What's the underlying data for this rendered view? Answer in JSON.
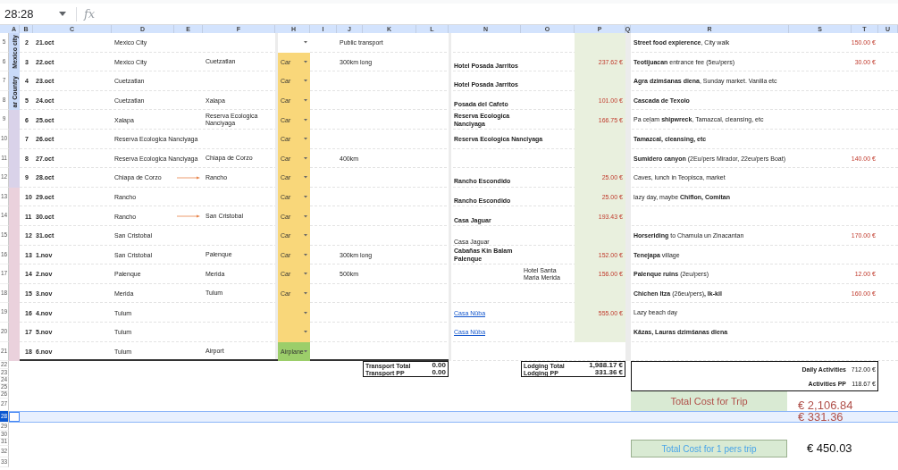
{
  "formula_bar": {
    "cell_ref": "28:28",
    "function_label": "fx"
  },
  "column_headers": [
    "A",
    "B",
    "C",
    "D",
    "E",
    "F",
    "H",
    "I",
    "J",
    "K",
    "L",
    "N",
    "O",
    "P",
    "Q",
    "R",
    "S",
    "T",
    "U"
  ],
  "row_headers": [
    {
      "label": "5",
      "selected": false
    },
    {
      "label": "6",
      "selected": false
    },
    {
      "label": "7",
      "selected": false
    },
    {
      "label": "8",
      "selected": false
    },
    {
      "label": "9",
      "selected": false
    },
    {
      "label": "10",
      "selected": false
    },
    {
      "label": "11",
      "selected": false
    },
    {
      "label": "12",
      "selected": false
    },
    {
      "label": "13",
      "selected": false
    },
    {
      "label": "14",
      "selected": false
    },
    {
      "label": "15",
      "selected": false
    },
    {
      "label": "16",
      "selected": false
    },
    {
      "label": "17",
      "selected": false
    },
    {
      "label": "18",
      "selected": false
    },
    {
      "label": "19",
      "selected": false
    },
    {
      "label": "20",
      "selected": false
    },
    {
      "label": "21",
      "selected": false
    },
    {
      "label": "22",
      "selected": false
    },
    {
      "label": "23",
      "selected": false
    },
    {
      "label": "24",
      "selected": false
    },
    {
      "label": "25",
      "selected": false
    },
    {
      "label": "26",
      "selected": false
    },
    {
      "label": "27",
      "selected": false
    },
    {
      "label": "28",
      "selected": true
    },
    {
      "label": "29",
      "selected": false
    },
    {
      "label": "30",
      "selected": false
    },
    {
      "label": "31",
      "selected": false
    },
    {
      "label": "32",
      "selected": false
    },
    {
      "label": "33",
      "selected": false
    }
  ],
  "groups": [
    {
      "label": "Mexico city",
      "color": "#c9daf8",
      "rows": [
        {
          "num": "2",
          "date": "21.oct",
          "from": "Mexico City",
          "transport": {
            "color": "#ffffff"
          },
          "note": "Public transport",
          "activity": {
            "text": "**Street food expierence**, City walk",
            "bold": false
          },
          "activity_cost": "150.00 €"
        },
        {
          "num": "3",
          "date": "22.oct",
          "from": "Mexico City",
          "to": "Cuetzatlan",
          "transport": {
            "value": "Car",
            "color": "#f9d77a"
          },
          "note": "300km long",
          "lodging": {
            "text": "Hotel Posada Jarritos",
            "kind": "bold"
          },
          "price": "237.62 €",
          "activity": {
            "text": "**Teotijuacan** entrance fee (5eu/pers)",
            "bold": false
          },
          "activity_cost": "30.00 €"
        }
      ]
    },
    {
      "label": "ar Country",
      "color": "#c9daf8",
      "rows": [
        {
          "num": "4",
          "date": "23.oct",
          "from": "Cuetzatlan",
          "transport": {
            "value": "Car",
            "color": "#f9d77a"
          },
          "lodging": {
            "text": "Hotel Posada Jarritos",
            "kind": "bold"
          },
          "activity": {
            "text": "**Agra dzimšanas diena**, Sunday market. Vanilla etc",
            "bold": false
          }
        },
        {
          "num": "5",
          "date": "24.oct",
          "from": "Cuetzatlan",
          "to": "Xalapa",
          "transport": {
            "value": "Car",
            "color": "#f9d77a"
          },
          "lodging": {
            "text": "Posada del Cafeto",
            "kind": "bold"
          },
          "price": "101.00 €",
          "activity": {
            "text": "Cascada de Texolo",
            "bold": true
          }
        }
      ]
    },
    {
      "color": "#d9d2e9",
      "rows": [
        {
          "num": "6",
          "date": "25.oct",
          "from": "Xalapa",
          "to": "Reserva Ecologica Nanciyaga",
          "transport": {
            "value": "Car",
            "color": "#f9d77a"
          },
          "lodging": {
            "text": "Reserva Ecologica Nanciyaga",
            "kind": "bold"
          },
          "price": "166.75 €",
          "activity": {
            "text": "Pa ceļam **shipwreck**, Tamazcal, cleansing, etc",
            "bold": false
          }
        },
        {
          "num": "7",
          "date": "26.oct",
          "from": "Reserva Ecologica Nanciyaga",
          "transport": {
            "value": "Car",
            "color": "#f9d77a"
          },
          "lodging": {
            "text": "Reserva Ecologica Nanciyaga",
            "kind": "small"
          },
          "activity": {
            "text": "Tamazcal, cleansing, etc",
            "bold": true
          }
        },
        {
          "num": "8",
          "date": "27.oct",
          "from": "Reserva Ecologica Nanciyaga",
          "to": "Chiapa de Corzo",
          "transport": {
            "value": "Car",
            "color": "#f9d77a"
          },
          "note": "400km",
          "activity": {
            "text": "**Sumidero canyon** (2Eu/pers Mirador, 22eu/pers Boat)",
            "bold": false
          },
          "activity_cost": "140.00 €"
        },
        {
          "num": "9",
          "date": "28.oct",
          "from": "Chiapa de Corzo",
          "arrow": true,
          "to": "Rancho",
          "transport": {
            "value": "Car",
            "color": "#f9d77a"
          },
          "lodging": {
            "text": "Rancho Escondido",
            "kind": "bold"
          },
          "price": "25.00 €",
          "activity": {
            "text": "Caves, lunch in Teopisca, market",
            "bold": false
          }
        }
      ]
    },
    {
      "color": "#ead1dc",
      "rows": [
        {
          "num": "10",
          "date": "29.oct",
          "from": "Rancho",
          "transport": {
            "value": "Car",
            "color": "#f9d77a"
          },
          "lodging": {
            "text": "Rancho Escondido",
            "kind": "bold"
          },
          "price": "25.00 €",
          "activity": {
            "text": "lazy day, maybe **Chiflon, Comitan**",
            "bold": false
          }
        },
        {
          "num": "11",
          "date": "30.oct",
          "from": "Rancho",
          "arrow": true,
          "to": "San Cristobal",
          "transport": {
            "value": "Car",
            "color": "#f9d77a"
          },
          "lodging": {
            "text": "Casa Jaguar",
            "kind": "bold"
          },
          "price": "193.43 €"
        },
        {
          "num": "12",
          "date": "31.oct",
          "from": "San Cristobal",
          "transport": {
            "value": "Car",
            "color": "#f9d77a"
          },
          "lodging": {
            "text": "Casa Jaguar",
            "kind": "plain"
          },
          "activity": {
            "text": "**Horseriding** to Chamula un Zinacantan",
            "bold": false
          },
          "activity_cost": "170.00 €"
        },
        {
          "num": "13",
          "date": "1.nov",
          "from": "San Cristobal",
          "to": "Palenque",
          "transport": {
            "value": "Car",
            "color": "#f9d77a"
          },
          "note": "300km long",
          "lodging": {
            "text": "Cabañas Kin Balam Palenque",
            "kind": "bold"
          },
          "price": "152.00 €",
          "activity": {
            "text": "**Tenejapa** village",
            "bold": false
          }
        },
        {
          "num": "14",
          "date": "2.nov",
          "from": "Palenque",
          "to": "Merida",
          "transport": {
            "value": "Car",
            "color": "#f9d77a"
          },
          "note": "500km",
          "lodging": {
            "text": "Hotel Santa Maria Merida",
            "kind": "note"
          },
          "price": "156.00 €",
          "activity": {
            "text": "**Palenque ruins** (2eu/pers)",
            "bold": false
          },
          "activity_cost": "12.00 €"
        },
        {
          "num": "15",
          "date": "3.nov",
          "from": "Merida",
          "to": "Tulum",
          "transport": {
            "value": "Car",
            "color": "#f9d77a"
          },
          "activity": {
            "text": "**Chichen Itza** (26eu/pers)**, Ik-kil**",
            "bold": false
          },
          "activity_cost": "160.00 €"
        },
        {
          "num": "16",
          "date": "4.nov",
          "from": "Tulum",
          "transport": {
            "color": "#f9d77a"
          },
          "lodging": {
            "text": "Casa Nūba",
            "kind": "link"
          },
          "price": "555.00 €",
          "activity": {
            "text": "Lazy beach day",
            "bold": false
          }
        },
        {
          "num": "17",
          "date": "5.nov",
          "from": "Tulum",
          "transport": {
            "color": "#f9d77a"
          },
          "lodging": {
            "text": "Casa Nūba",
            "kind": "link"
          },
          "activity": {
            "text": "Kāzas, Lauras dzimšanas diena",
            "bold": true
          }
        },
        {
          "num": "18",
          "date": "6.nov",
          "from": "Tulum",
          "to": "Airport",
          "transport": {
            "value": "Airplane",
            "color": "#9cce6a"
          }
        }
      ]
    }
  ],
  "transport_totals": [
    {
      "label": "Transport Total",
      "value": "0.00"
    },
    {
      "label": "Transport PP",
      "value": "0.00"
    }
  ],
  "lodging_totals": [
    {
      "label": "Lodging Total",
      "value": "1,988.17 €"
    },
    {
      "label": "Lodging PP",
      "value": "331.36 €"
    }
  ],
  "activity_totals": [
    {
      "label": "Daily Activities",
      "value": "712.00 €"
    },
    {
      "label": "Activities PP",
      "value": "118.67 €"
    }
  ],
  "trip_total": {
    "label": "Total Cost for Trip",
    "value": "€ 2,106.84"
  },
  "selected_row_value": "€ 331.36",
  "per_person_total": {
    "label": "Total Cost for 1 pers trip",
    "value": "€ 450.03"
  }
}
